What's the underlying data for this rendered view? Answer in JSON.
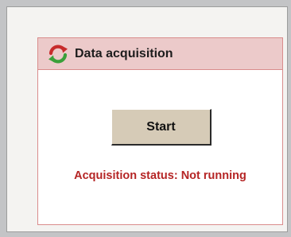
{
  "panel": {
    "title": "Data acquisition",
    "icon": "refresh-arrows-icon"
  },
  "controls": {
    "start_label": "Start"
  },
  "status": {
    "prefix": "Acquisition status:",
    "value": "Not running",
    "color": "#b52525"
  },
  "colors": {
    "background": "#c3c4c6",
    "panel_header": "#eccaca",
    "panel_border": "#d98c8c",
    "button_face": "#d6cbb7"
  }
}
